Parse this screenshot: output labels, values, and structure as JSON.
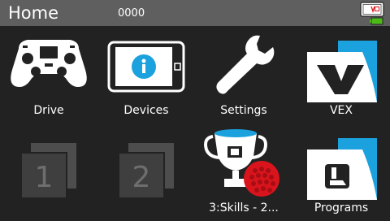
{
  "header": {
    "title": "Home",
    "counter": "0000"
  },
  "status_icon": "brain-battery-icon",
  "apps": [
    {
      "label": "Drive",
      "icon": "gamepad-icon"
    },
    {
      "label": "Devices",
      "icon": "brain-info-icon"
    },
    {
      "label": "Settings",
      "icon": "wrench-icon"
    },
    {
      "label": "VEX",
      "icon": "vex-folder-icon"
    },
    {
      "label": "",
      "icon": "slot-1-icon",
      "slot_number": "1"
    },
    {
      "label": "",
      "icon": "slot-2-icon",
      "slot_number": "2"
    },
    {
      "label": "3:Skills - 2...",
      "icon": "trophy-ball-icon"
    },
    {
      "label": "Programs",
      "icon": "programs-folder-icon"
    }
  ],
  "colors": {
    "header_bg": "#5f5f5f",
    "screen_bg": "#222222",
    "accent_blue": "#1ba1dd",
    "ball_red": "#d9141c",
    "battery_green": "#4cbb17"
  }
}
